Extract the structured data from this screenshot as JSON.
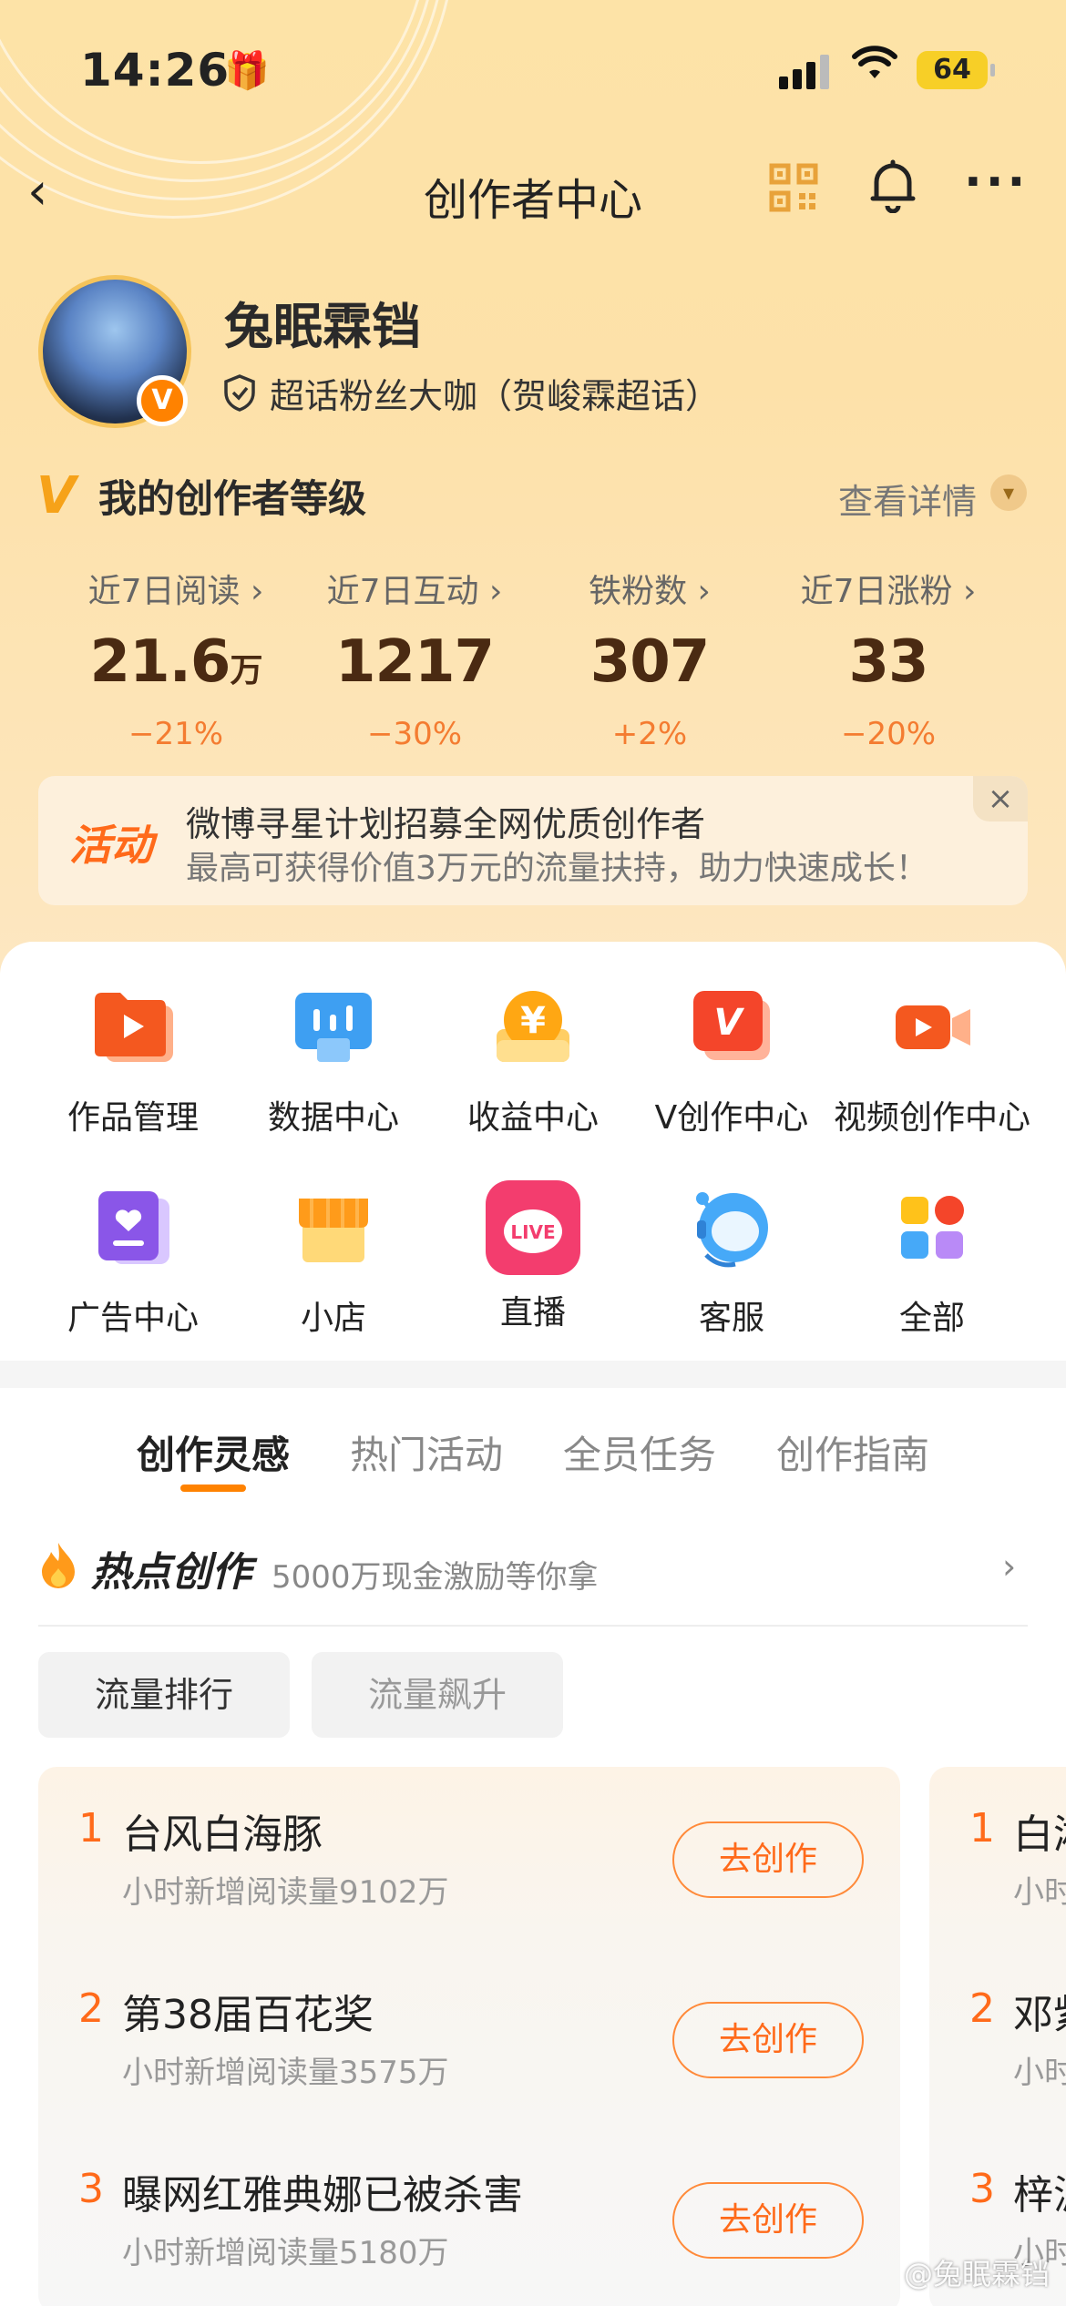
{
  "status_bar": {
    "time": "14:26",
    "battery": "64"
  },
  "nav": {
    "back_glyph": "‹",
    "title": "创作者中心"
  },
  "profile": {
    "name": "兔眠霖铛",
    "badge": "V",
    "tag": "超话粉丝大咖（贺峻霖超话）"
  },
  "level": {
    "title": "我的创作者等级",
    "detail_label": "查看详情"
  },
  "stats": [
    {
      "label": "近7日阅读 ›",
      "value": "21.6",
      "unit": "万",
      "change": "−21%"
    },
    {
      "label": "近7日互动 ›",
      "value": "1217",
      "unit": "",
      "change": "−30%"
    },
    {
      "label": "铁粉数 ›",
      "value": "307",
      "unit": "",
      "change": "+2%"
    },
    {
      "label": "近7日涨粉 ›",
      "value": "33",
      "unit": "",
      "change": "−20%"
    }
  ],
  "banner": {
    "tag": "活动",
    "line1": "微博寻星计划招募全网优质创作者",
    "line2": "最高可获得价值3万元的流量扶持，助力快速成长！",
    "close": "×"
  },
  "grid": [
    {
      "label": "作品管理",
      "icon": "play-folder-icon"
    },
    {
      "label": "数据中心",
      "icon": "data-chart-icon"
    },
    {
      "label": "收益中心",
      "icon": "coin-yen-icon"
    },
    {
      "label": "V创作中心",
      "icon": "v-creator-icon"
    },
    {
      "label": "视频创作中心",
      "icon": "video-camera-icon"
    },
    {
      "label": "广告中心",
      "icon": "ad-heart-icon"
    },
    {
      "label": "小店",
      "icon": "shop-icon"
    },
    {
      "label": "直播",
      "icon": "live-icon"
    },
    {
      "label": "客服",
      "icon": "customer-service-icon"
    },
    {
      "label": "全部",
      "icon": "all-apps-icon"
    }
  ],
  "tabs": [
    "创作灵感",
    "热门活动",
    "全员任务",
    "创作指南"
  ],
  "hot": {
    "title": "热点创作",
    "subtitle": "5000万现金激励等你拿"
  },
  "filters": [
    "流量排行",
    "流量飙升"
  ],
  "ranking": [
    {
      "rank": "1",
      "title": "台风白海豚",
      "sub": "小时新增阅读量9102万",
      "action": "去创作"
    },
    {
      "rank": "2",
      "title": "第38届百花奖",
      "sub": "小时新增阅读量3575万",
      "action": "去创作"
    },
    {
      "rank": "3",
      "title": "曝网红雅典娜已被杀害",
      "sub": "小时新增阅读量5180万",
      "action": "去创作"
    }
  ],
  "ranking_peek": [
    {
      "rank": "1",
      "title": "白湘",
      "sub": "小时"
    },
    {
      "rank": "2",
      "title": "邓紫",
      "sub": "小时"
    },
    {
      "rank": "3",
      "title": "梓湄",
      "sub": "小时"
    }
  ],
  "watermark": "@兔眠霖铛",
  "colors": {
    "accent": "#ff8200",
    "rank": "#ff6a1a",
    "header_bg": "#fde3a7"
  }
}
